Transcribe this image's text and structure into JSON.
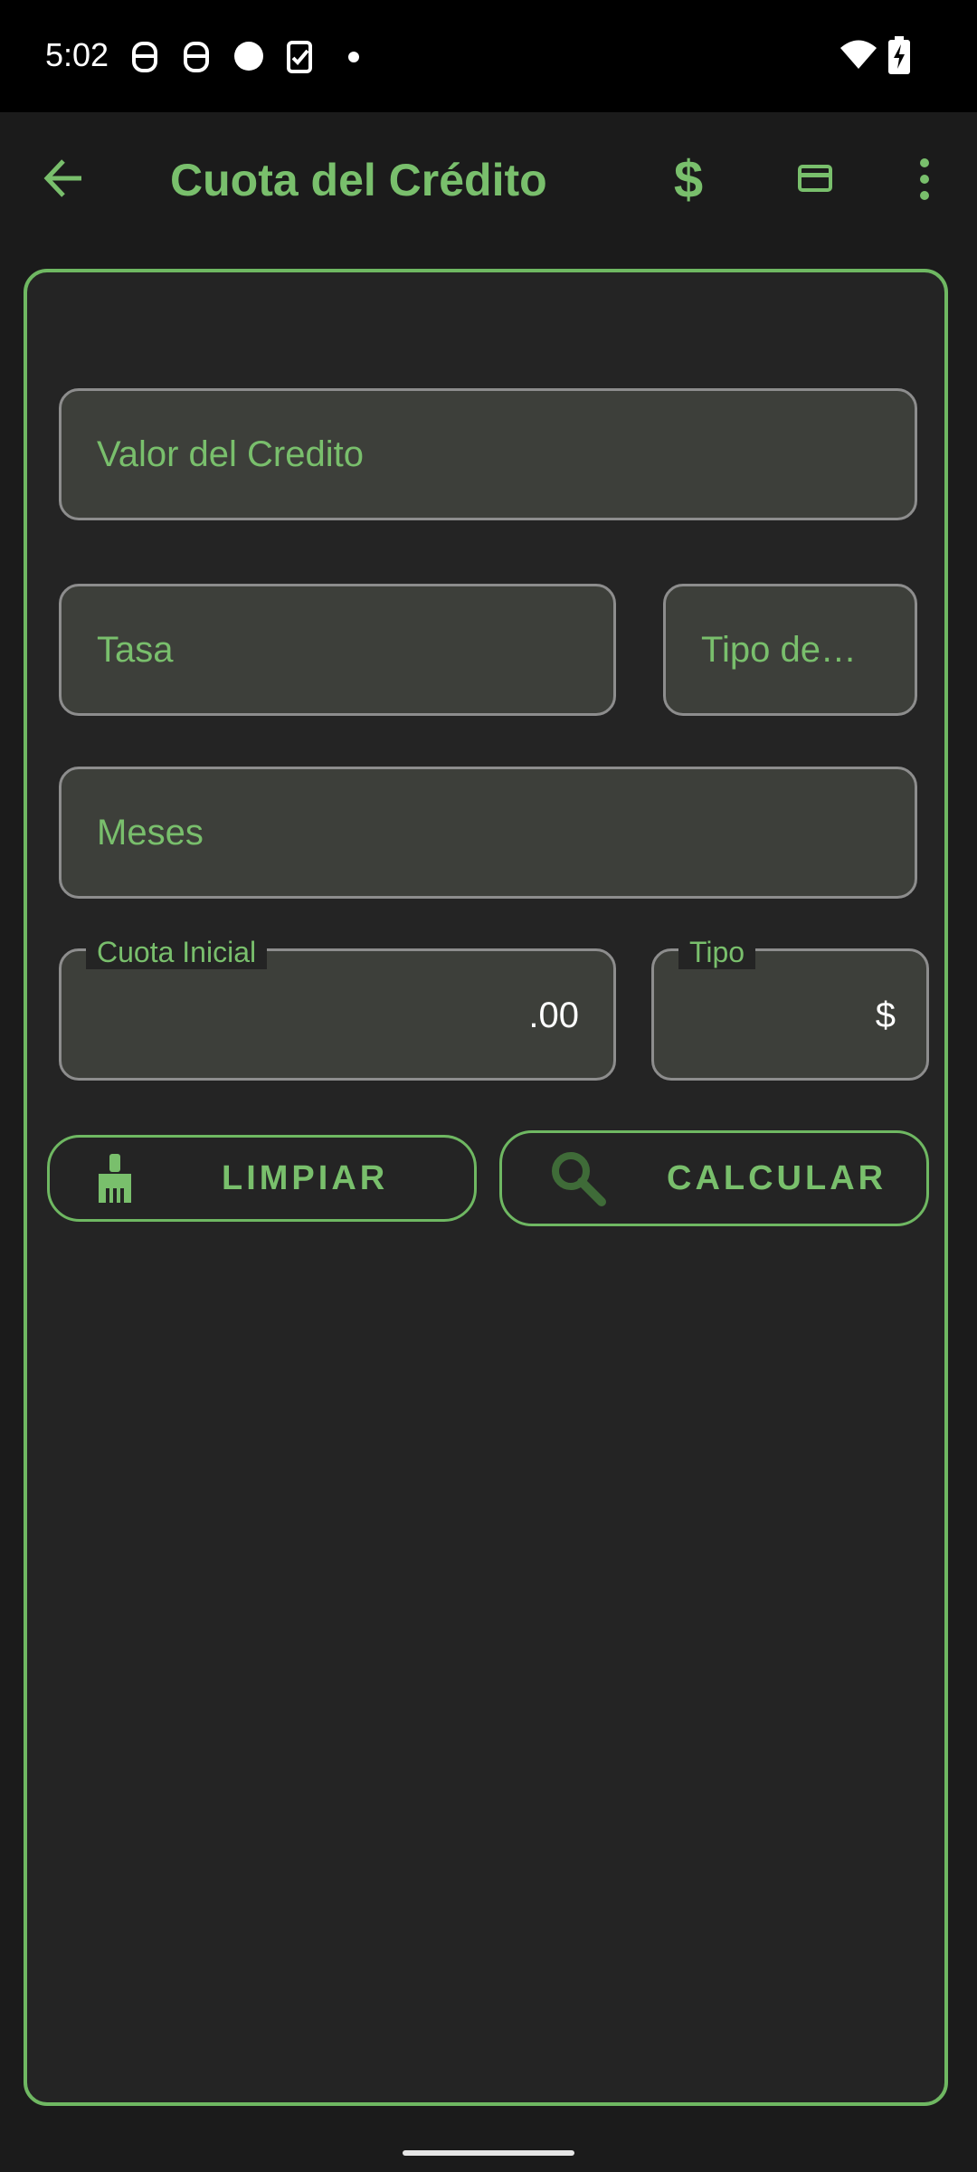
{
  "status_bar": {
    "time": "5:02",
    "icons": [
      "face-icon",
      "face-icon",
      "circle-icon",
      "clipboard-check-icon",
      "dot-icon",
      "wifi-icon",
      "battery-charging-icon"
    ]
  },
  "app_bar": {
    "title": "Cuota del Crédito",
    "icons": [
      "back-arrow-icon",
      "dollar-icon",
      "credit-card-icon",
      "more-vert-icon"
    ]
  },
  "form": {
    "credit_value_placeholder": "Valor del Credito",
    "rate_placeholder": "Tasa",
    "rate_type_placeholder": "Tipo de…",
    "months_placeholder": "Meses",
    "initial_payment_label": "Cuota Inicial",
    "initial_payment_value": ".00",
    "type_label": "Tipo",
    "type_value": "$"
  },
  "buttons": {
    "clear_label": "LIMPIAR",
    "clear_icon": "broom-icon",
    "calculate_label": "CALCULAR",
    "calculate_icon": "search-icon"
  },
  "colors": {
    "accent": "#79bf6c",
    "background": "#1b1b1b",
    "card": "#242424",
    "field": "#3d3f3a"
  }
}
